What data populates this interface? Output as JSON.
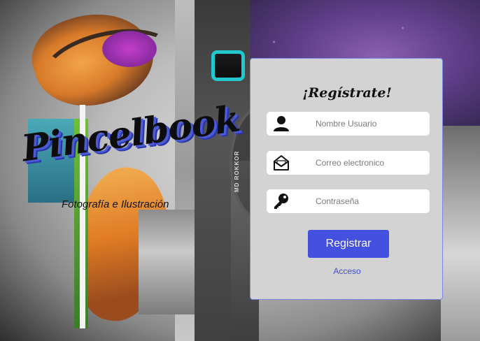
{
  "brand": {
    "title": "Pincelbook",
    "subtitle": "Fotografía e Ilustración"
  },
  "background": {
    "lens_text": "MD ROKKOR"
  },
  "form": {
    "title": "¡Regístrate!",
    "fields": [
      {
        "placeholder": "Nombre Usuario",
        "icon": "user-icon"
      },
      {
        "placeholder": "Correo electronico",
        "icon": "envelope-icon"
      },
      {
        "placeholder": "Contraseña",
        "icon": "key-icon"
      }
    ],
    "submit_label": "Registrar",
    "login_link": "Acceso"
  },
  "colors": {
    "accent": "#4450e0",
    "link": "#3f4ad8",
    "card_bg": "#d3d3d3",
    "card_border": "#7c86e8"
  }
}
